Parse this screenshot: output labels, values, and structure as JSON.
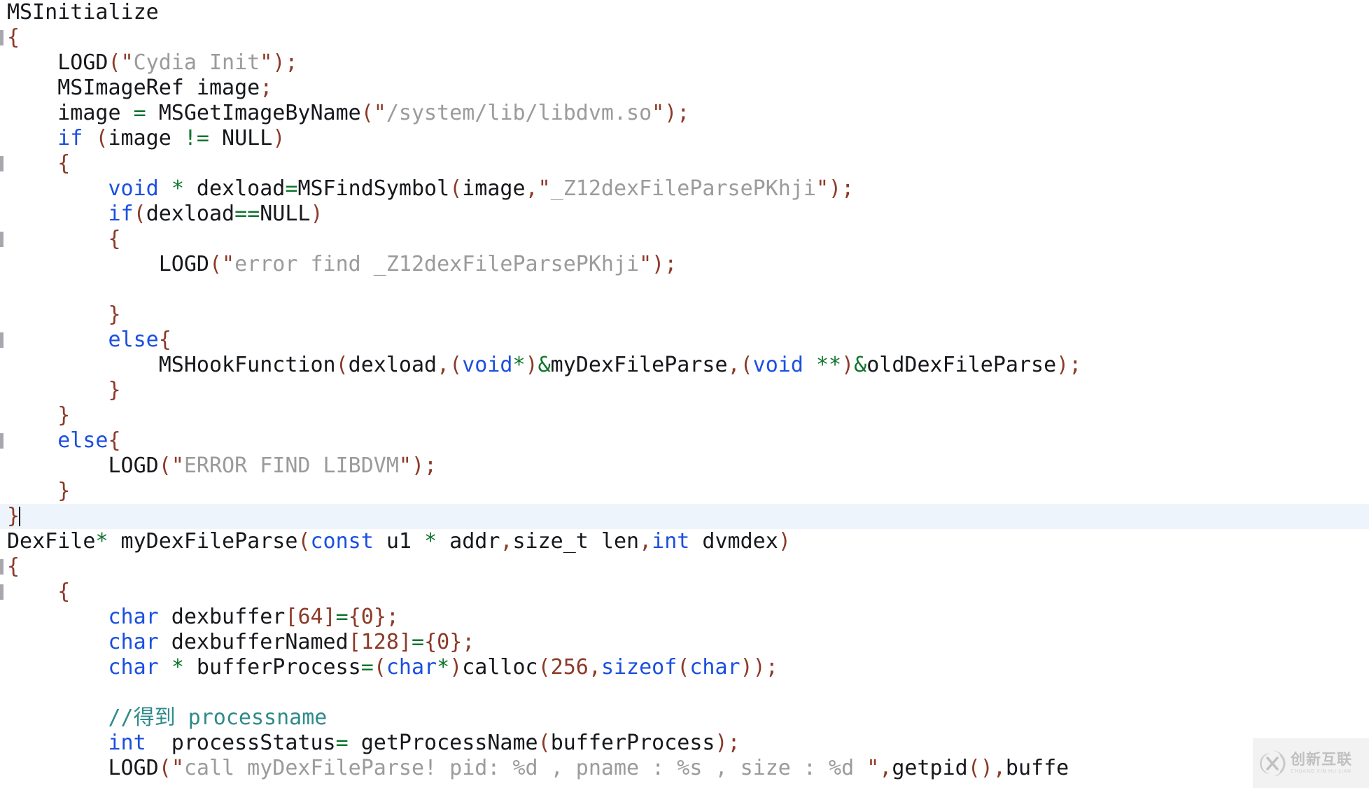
{
  "editor": {
    "language": "cpp",
    "theme": "light",
    "background_color": "#ffffff",
    "current_line_highlight_color": "#eef4fb",
    "colors": {
      "plain": "#16181c",
      "keyword": "#1a4fe0",
      "string": "#9b9b9b",
      "punctuation": "#8c3a28",
      "operator": "#11752e",
      "number": "#8c3a28",
      "comment": "#2f8a8a"
    },
    "caret_line_index": 18
  },
  "lines": [
    {
      "n": 0,
      "fold": false,
      "current": false,
      "tokens": [
        {
          "t": "plain",
          "v": "MSInitialize"
        }
      ]
    },
    {
      "n": 1,
      "fold": true,
      "current": false,
      "tokens": [
        {
          "t": "punct",
          "v": "{"
        }
      ]
    },
    {
      "n": 2,
      "fold": false,
      "current": false,
      "tokens": [
        {
          "t": "plain",
          "v": "    LOGD"
        },
        {
          "t": "punct",
          "v": "("
        },
        {
          "t": "punct",
          "v": "\""
        },
        {
          "t": "str",
          "v": "Cydia Init"
        },
        {
          "t": "punct",
          "v": "\""
        },
        {
          "t": "punct",
          "v": ");"
        }
      ]
    },
    {
      "n": 3,
      "fold": false,
      "current": false,
      "tokens": [
        {
          "t": "plain",
          "v": "    MSImageRef image"
        },
        {
          "t": "punct",
          "v": ";"
        }
      ]
    },
    {
      "n": 4,
      "fold": false,
      "current": false,
      "tokens": [
        {
          "t": "plain",
          "v": "    image "
        },
        {
          "t": "op",
          "v": "="
        },
        {
          "t": "plain",
          "v": " MSGetImageByName"
        },
        {
          "t": "punct",
          "v": "("
        },
        {
          "t": "punct",
          "v": "\""
        },
        {
          "t": "str",
          "v": "/system/lib/libdvm.so"
        },
        {
          "t": "punct",
          "v": "\""
        },
        {
          "t": "punct",
          "v": ");"
        }
      ]
    },
    {
      "n": 5,
      "fold": false,
      "current": false,
      "tokens": [
        {
          "t": "plain",
          "v": "    "
        },
        {
          "t": "kw",
          "v": "if"
        },
        {
          "t": "plain",
          "v": " "
        },
        {
          "t": "punct",
          "v": "("
        },
        {
          "t": "plain",
          "v": "image "
        },
        {
          "t": "op",
          "v": "!="
        },
        {
          "t": "plain",
          "v": " NULL"
        },
        {
          "t": "punct",
          "v": ")"
        }
      ]
    },
    {
      "n": 6,
      "fold": true,
      "current": false,
      "tokens": [
        {
          "t": "plain",
          "v": "    "
        },
        {
          "t": "punct",
          "v": "{"
        }
      ]
    },
    {
      "n": 7,
      "fold": false,
      "current": false,
      "tokens": [
        {
          "t": "plain",
          "v": "        "
        },
        {
          "t": "kw",
          "v": "void"
        },
        {
          "t": "plain",
          "v": " "
        },
        {
          "t": "op",
          "v": "*"
        },
        {
          "t": "plain",
          "v": " dexload"
        },
        {
          "t": "op",
          "v": "="
        },
        {
          "t": "plain",
          "v": "MSFindSymbol"
        },
        {
          "t": "punct",
          "v": "("
        },
        {
          "t": "plain",
          "v": "image"
        },
        {
          "t": "punct",
          "v": ","
        },
        {
          "t": "punct",
          "v": "\""
        },
        {
          "t": "str",
          "v": "_Z12dexFileParsePKhji"
        },
        {
          "t": "punct",
          "v": "\""
        },
        {
          "t": "punct",
          "v": ");"
        }
      ]
    },
    {
      "n": 8,
      "fold": false,
      "current": false,
      "tokens": [
        {
          "t": "plain",
          "v": "        "
        },
        {
          "t": "kw",
          "v": "if"
        },
        {
          "t": "punct",
          "v": "("
        },
        {
          "t": "plain",
          "v": "dexload"
        },
        {
          "t": "op",
          "v": "=="
        },
        {
          "t": "plain",
          "v": "NULL"
        },
        {
          "t": "punct",
          "v": ")"
        }
      ]
    },
    {
      "n": 9,
      "fold": true,
      "current": false,
      "tokens": [
        {
          "t": "plain",
          "v": "        "
        },
        {
          "t": "punct",
          "v": "{"
        }
      ]
    },
    {
      "n": 10,
      "fold": false,
      "current": false,
      "tokens": [
        {
          "t": "plain",
          "v": "            LOGD"
        },
        {
          "t": "punct",
          "v": "("
        },
        {
          "t": "punct",
          "v": "\""
        },
        {
          "t": "str",
          "v": "error find _Z12dexFileParsePKhji"
        },
        {
          "t": "punct",
          "v": "\""
        },
        {
          "t": "punct",
          "v": ");"
        }
      ]
    },
    {
      "n": 11,
      "fold": false,
      "current": false,
      "tokens": []
    },
    {
      "n": 12,
      "fold": false,
      "current": false,
      "tokens": [
        {
          "t": "plain",
          "v": "        "
        },
        {
          "t": "punct",
          "v": "}"
        }
      ]
    },
    {
      "n": 13,
      "fold": true,
      "current": false,
      "tokens": [
        {
          "t": "plain",
          "v": "        "
        },
        {
          "t": "kw",
          "v": "else"
        },
        {
          "t": "punct",
          "v": "{"
        }
      ]
    },
    {
      "n": 14,
      "fold": false,
      "current": false,
      "tokens": [
        {
          "t": "plain",
          "v": "            MSHookFunction"
        },
        {
          "t": "punct",
          "v": "("
        },
        {
          "t": "plain",
          "v": "dexload"
        },
        {
          "t": "punct",
          "v": ",("
        },
        {
          "t": "kw",
          "v": "void"
        },
        {
          "t": "op",
          "v": "*"
        },
        {
          "t": "punct",
          "v": ")"
        },
        {
          "t": "op",
          "v": "&"
        },
        {
          "t": "plain",
          "v": "myDexFileParse"
        },
        {
          "t": "punct",
          "v": ",("
        },
        {
          "t": "kw",
          "v": "void"
        },
        {
          "t": "plain",
          "v": " "
        },
        {
          "t": "op",
          "v": "**"
        },
        {
          "t": "punct",
          "v": ")"
        },
        {
          "t": "op",
          "v": "&"
        },
        {
          "t": "plain",
          "v": "oldDexFileParse"
        },
        {
          "t": "punct",
          "v": ");"
        }
      ]
    },
    {
      "n": 15,
      "fold": false,
      "current": false,
      "tokens": [
        {
          "t": "plain",
          "v": "        "
        },
        {
          "t": "punct",
          "v": "}"
        }
      ]
    },
    {
      "n": 16,
      "fold": false,
      "current": false,
      "tokens": [
        {
          "t": "plain",
          "v": "    "
        },
        {
          "t": "punct",
          "v": "}"
        }
      ]
    },
    {
      "n": 17,
      "fold": true,
      "current": false,
      "tokens": [
        {
          "t": "plain",
          "v": "    "
        },
        {
          "t": "kw",
          "v": "else"
        },
        {
          "t": "punct",
          "v": "{"
        }
      ]
    },
    {
      "n": 18,
      "fold": false,
      "current": false,
      "tokens": [
        {
          "t": "plain",
          "v": "        LOGD"
        },
        {
          "t": "punct",
          "v": "("
        },
        {
          "t": "punct",
          "v": "\""
        },
        {
          "t": "str",
          "v": "ERROR FIND LIBDVM"
        },
        {
          "t": "punct",
          "v": "\""
        },
        {
          "t": "punct",
          "v": ");"
        }
      ]
    },
    {
      "n": 19,
      "fold": false,
      "current": false,
      "tokens": [
        {
          "t": "plain",
          "v": "    "
        },
        {
          "t": "punct",
          "v": "}"
        }
      ]
    },
    {
      "n": 20,
      "fold": false,
      "current": true,
      "caret": true,
      "tokens": [
        {
          "t": "punct",
          "v": "}"
        }
      ]
    },
    {
      "n": 21,
      "fold": false,
      "current": false,
      "tokens": [
        {
          "t": "plain",
          "v": "DexFile"
        },
        {
          "t": "op",
          "v": "*"
        },
        {
          "t": "plain",
          "v": " myDexFileParse"
        },
        {
          "t": "punct",
          "v": "("
        },
        {
          "t": "kw",
          "v": "const"
        },
        {
          "t": "plain",
          "v": " u1 "
        },
        {
          "t": "op",
          "v": "*"
        },
        {
          "t": "plain",
          "v": " addr"
        },
        {
          "t": "punct",
          "v": ","
        },
        {
          "t": "plain",
          "v": "size_t len"
        },
        {
          "t": "punct",
          "v": ","
        },
        {
          "t": "kw",
          "v": "int"
        },
        {
          "t": "plain",
          "v": " dvmdex"
        },
        {
          "t": "punct",
          "v": ")"
        }
      ]
    },
    {
      "n": 22,
      "fold": true,
      "current": false,
      "tokens": [
        {
          "t": "punct",
          "v": "{"
        }
      ]
    },
    {
      "n": 23,
      "fold": true,
      "current": false,
      "tokens": [
        {
          "t": "plain",
          "v": "    "
        },
        {
          "t": "punct",
          "v": "{"
        }
      ]
    },
    {
      "n": 24,
      "fold": false,
      "current": false,
      "tokens": [
        {
          "t": "plain",
          "v": "        "
        },
        {
          "t": "kw",
          "v": "char"
        },
        {
          "t": "plain",
          "v": " dexbuffer"
        },
        {
          "t": "punct",
          "v": "["
        },
        {
          "t": "num",
          "v": "64"
        },
        {
          "t": "punct",
          "v": "]"
        },
        {
          "t": "op",
          "v": "="
        },
        {
          "t": "punct",
          "v": "{"
        },
        {
          "t": "num",
          "v": "0"
        },
        {
          "t": "punct",
          "v": "};"
        }
      ]
    },
    {
      "n": 25,
      "fold": false,
      "current": false,
      "tokens": [
        {
          "t": "plain",
          "v": "        "
        },
        {
          "t": "kw",
          "v": "char"
        },
        {
          "t": "plain",
          "v": " dexbufferNamed"
        },
        {
          "t": "punct",
          "v": "["
        },
        {
          "t": "num",
          "v": "128"
        },
        {
          "t": "punct",
          "v": "]"
        },
        {
          "t": "op",
          "v": "="
        },
        {
          "t": "punct",
          "v": "{"
        },
        {
          "t": "num",
          "v": "0"
        },
        {
          "t": "punct",
          "v": "};"
        }
      ]
    },
    {
      "n": 26,
      "fold": false,
      "current": false,
      "tokens": [
        {
          "t": "plain",
          "v": "        "
        },
        {
          "t": "kw",
          "v": "char"
        },
        {
          "t": "plain",
          "v": " "
        },
        {
          "t": "op",
          "v": "*"
        },
        {
          "t": "plain",
          "v": " bufferProcess"
        },
        {
          "t": "op",
          "v": "="
        },
        {
          "t": "punct",
          "v": "("
        },
        {
          "t": "kw",
          "v": "char"
        },
        {
          "t": "op",
          "v": "*"
        },
        {
          "t": "punct",
          "v": ")"
        },
        {
          "t": "plain",
          "v": "calloc"
        },
        {
          "t": "punct",
          "v": "("
        },
        {
          "t": "num",
          "v": "256"
        },
        {
          "t": "punct",
          "v": ","
        },
        {
          "t": "kw",
          "v": "sizeof"
        },
        {
          "t": "punct",
          "v": "("
        },
        {
          "t": "kw",
          "v": "char"
        },
        {
          "t": "punct",
          "v": "));"
        }
      ]
    },
    {
      "n": 27,
      "fold": false,
      "current": false,
      "tokens": []
    },
    {
      "n": 28,
      "fold": false,
      "current": false,
      "tokens": [
        {
          "t": "plain",
          "v": "        "
        },
        {
          "t": "cmt",
          "v": "//得到 processname"
        }
      ]
    },
    {
      "n": 29,
      "fold": false,
      "current": false,
      "tokens": [
        {
          "t": "plain",
          "v": "        "
        },
        {
          "t": "kw",
          "v": "int"
        },
        {
          "t": "plain",
          "v": "  processStatus"
        },
        {
          "t": "op",
          "v": "="
        },
        {
          "t": "plain",
          "v": " getProcessName"
        },
        {
          "t": "punct",
          "v": "("
        },
        {
          "t": "plain",
          "v": "bufferProcess"
        },
        {
          "t": "punct",
          "v": ");"
        }
      ]
    },
    {
      "n": 30,
      "fold": false,
      "current": false,
      "tokens": [
        {
          "t": "plain",
          "v": "        LOGD"
        },
        {
          "t": "punct",
          "v": "("
        },
        {
          "t": "punct",
          "v": "\""
        },
        {
          "t": "str",
          "v": "call myDexFileParse! pid: %d , pname : %s , size : %d "
        },
        {
          "t": "punct",
          "v": "\""
        },
        {
          "t": "punct",
          "v": ","
        },
        {
          "t": "plain",
          "v": "getpid"
        },
        {
          "t": "punct",
          "v": "()"
        },
        {
          "t": "punct",
          "v": ","
        },
        {
          "t": "plain",
          "v": "buffe"
        }
      ]
    }
  ],
  "watermark": {
    "cn_text": "创新互联",
    "en_text": "CHUANG XIN HU LIAN",
    "logo_letter": "X"
  }
}
